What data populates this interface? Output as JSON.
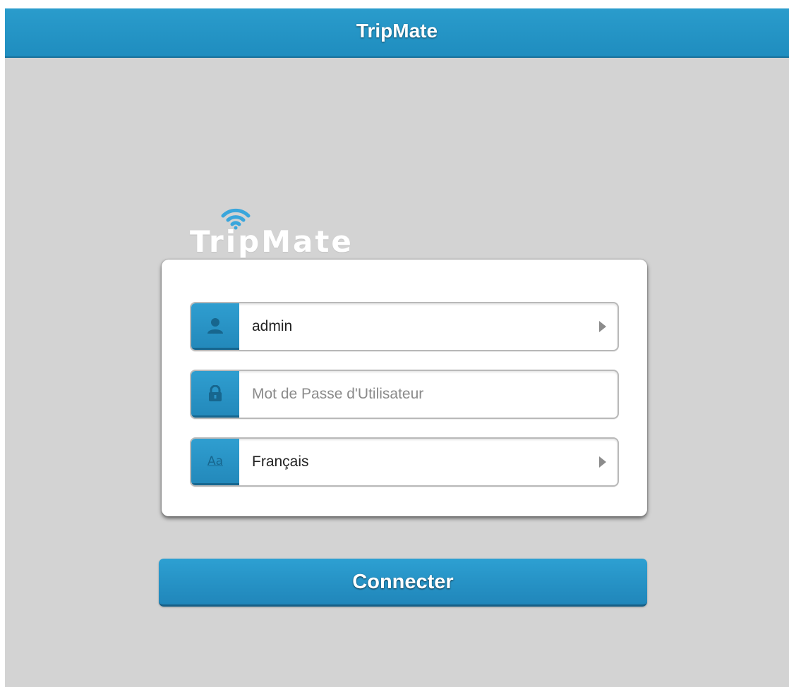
{
  "header": {
    "title": "TripMate"
  },
  "logo": {
    "text": "TripMate",
    "icon": "wifi-icon"
  },
  "login_form": {
    "username": {
      "icon": "user-icon",
      "value": "admin"
    },
    "password": {
      "icon": "lock-icon",
      "placeholder": "Mot de Passe d'Utilisateur",
      "value": ""
    },
    "language": {
      "icon": "font-icon",
      "icon_text": "Aa",
      "value": "Français"
    }
  },
  "connect_button": {
    "label": "Connecter"
  },
  "colors": {
    "accent": "#2196c9",
    "background": "#d3d3d3",
    "card": "#ffffff"
  }
}
